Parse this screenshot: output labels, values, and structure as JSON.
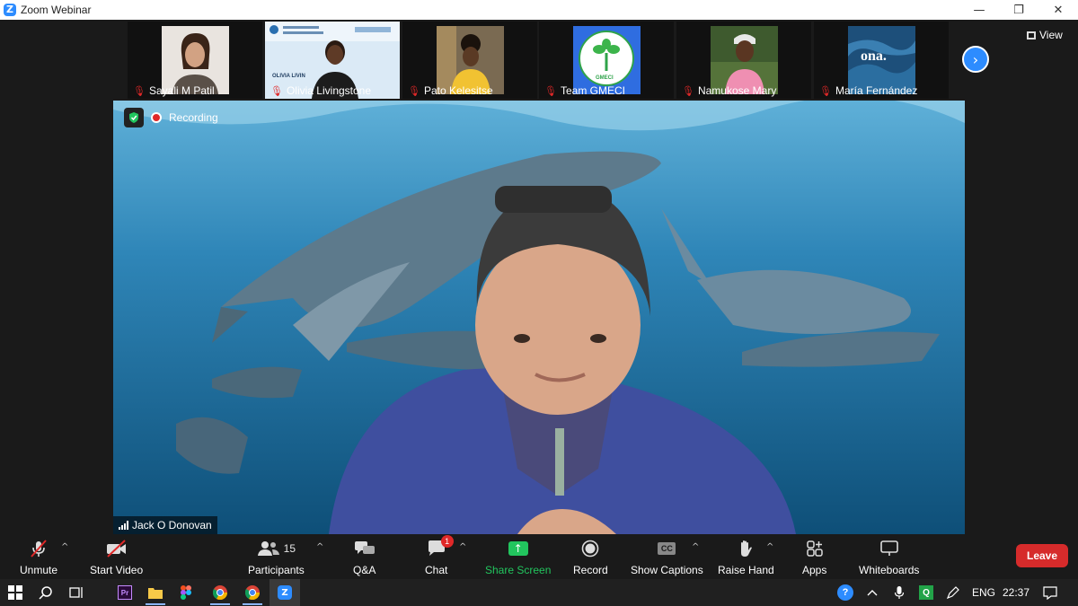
{
  "window": {
    "title": "Zoom Webinar",
    "minimize": "—",
    "restore": "❐",
    "close": "✕"
  },
  "gallery": {
    "participants": [
      {
        "name": "Sayali M Patil"
      },
      {
        "name": "Olivia Livingstone"
      },
      {
        "name": "Pato Kelesitse"
      },
      {
        "name": "Team GMECI"
      },
      {
        "name": "Namukose Mary"
      },
      {
        "name": "María Fernández"
      }
    ],
    "thumbnail_texts": {
      "olivia_slide": "OLIVIA LIVIN",
      "gmeci_logo": "GMECI",
      "ona_logo": "ona."
    },
    "next_icon": "›",
    "view_label": "View"
  },
  "main": {
    "recording_label": "Recording",
    "speaker_name": "Jack O Donovan"
  },
  "toolbar": {
    "unmute": "Unmute",
    "start_video": "Start Video",
    "participants": "Participants",
    "participants_count": "15",
    "qa": "Q&A",
    "chat": "Chat",
    "chat_badge": "1",
    "share_screen": "Share Screen",
    "record": "Record",
    "show_captions": "Show Captions",
    "cc": "CC",
    "raise_hand": "Raise Hand",
    "apps": "Apps",
    "whiteboards": "Whiteboards",
    "leave": "Leave",
    "caret": "^"
  },
  "taskbar": {
    "premiere_label": "Pr",
    "zoom_label": "Z",
    "language": "ENG",
    "time": "22:37",
    "help_icon": "?",
    "q_label": "Q"
  },
  "colors": {
    "accent_blue": "#2d8cff",
    "leave_red": "#d62b2b",
    "share_green": "#22c55e",
    "mic_muted_red": "#e02828"
  }
}
